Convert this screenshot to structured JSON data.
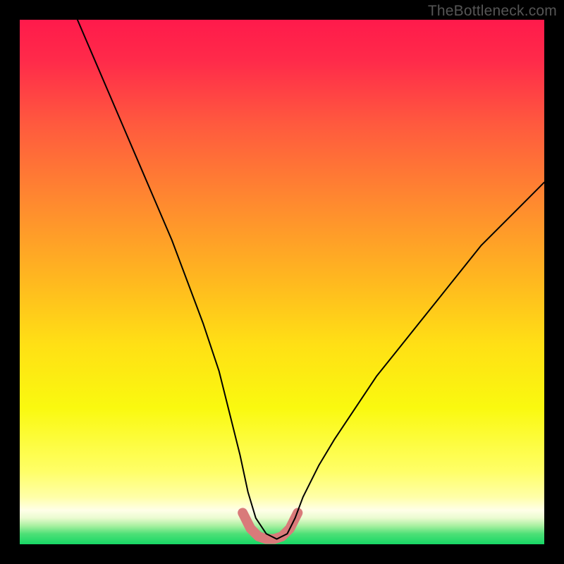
{
  "watermark": "TheBottleneck.com",
  "colors": {
    "frame": "#000000",
    "gradient_stops": [
      {
        "offset": 0.0,
        "color": "#ff1a4b"
      },
      {
        "offset": 0.08,
        "color": "#ff2b4a"
      },
      {
        "offset": 0.2,
        "color": "#ff5a3e"
      },
      {
        "offset": 0.35,
        "color": "#ff8a2f"
      },
      {
        "offset": 0.5,
        "color": "#ffb91f"
      },
      {
        "offset": 0.62,
        "color": "#ffe015"
      },
      {
        "offset": 0.74,
        "color": "#faf90f"
      },
      {
        "offset": 0.86,
        "color": "#ffff66"
      },
      {
        "offset": 0.91,
        "color": "#ffffa8"
      },
      {
        "offset": 0.935,
        "color": "#ffffe8"
      },
      {
        "offset": 0.95,
        "color": "#eafbd0"
      },
      {
        "offset": 0.965,
        "color": "#a7f0a0"
      },
      {
        "offset": 0.98,
        "color": "#4ee077"
      },
      {
        "offset": 1.0,
        "color": "#17d765"
      }
    ],
    "curve": "#000000",
    "valley_marker": "#d97a7a"
  },
  "chart_data": {
    "type": "line",
    "title": "",
    "xlabel": "",
    "ylabel": "",
    "xlim": [
      0,
      100
    ],
    "ylim": [
      0,
      100
    ],
    "grid": false,
    "legend": false,
    "series": [
      {
        "name": "bottleneck-curve",
        "x": [
          11,
          14,
          17,
          20,
          23,
          26,
          29,
          32,
          35,
          38,
          40,
          42,
          43.5,
          45,
          47,
          49,
          51,
          52.5,
          54,
          57,
          60,
          64,
          68,
          72,
          76,
          80,
          84,
          88,
          92,
          96,
          100
        ],
        "y": [
          100,
          93,
          86,
          79,
          72,
          65,
          58,
          50,
          42,
          33,
          25,
          17,
          10,
          5,
          2,
          1,
          2,
          5,
          9,
          15,
          20,
          26,
          32,
          37,
          42,
          47,
          52,
          57,
          61,
          65,
          69
        ]
      }
    ],
    "valley_marker": {
      "x": [
        42.5,
        44,
        45.5,
        47,
        48.5,
        50,
        51.5,
        53
      ],
      "y": [
        6,
        3,
        1.5,
        1,
        1,
        1.5,
        3,
        6
      ]
    }
  }
}
